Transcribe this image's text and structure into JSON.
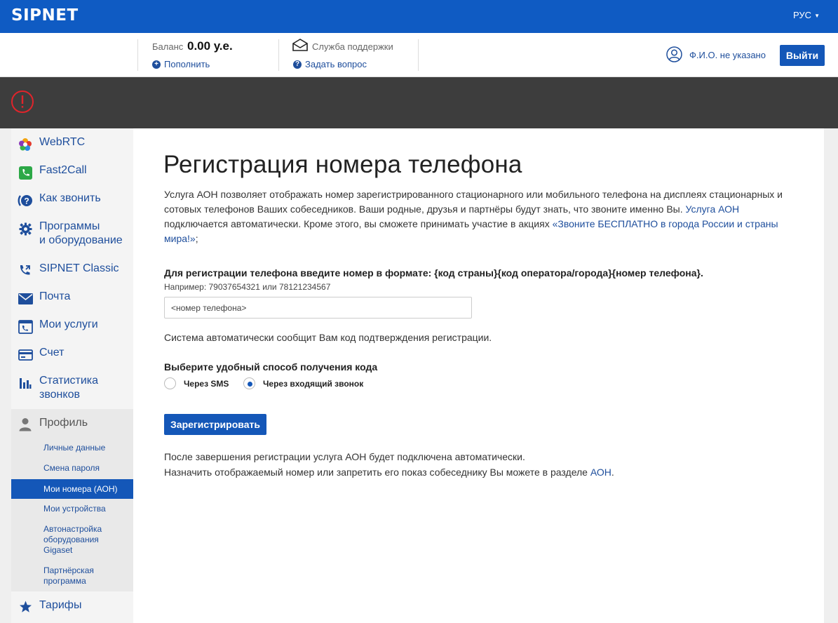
{
  "header": {
    "logo": "SIPNET",
    "language": "РУС"
  },
  "account": {
    "balance_label": "Баланс",
    "balance_value": "0.00 у.е.",
    "topup_label": "Пополнить",
    "support_label": "Служба поддержки",
    "ask_label": "Задать вопрос",
    "user_name": "Ф.И.О. не указано",
    "logout_label": "Выйти"
  },
  "sidebar": {
    "items": [
      {
        "label": "WebRTC",
        "icon": "webrtc-icon"
      },
      {
        "label": "Fast2Call",
        "icon": "phone-icon"
      },
      {
        "label": "Как звонить",
        "icon": "help-call-icon"
      },
      {
        "label": "Программы",
        "label2": "и оборудование",
        "icon": "gear-icon"
      },
      {
        "label": "SIPNET Classic",
        "icon": "phone-classic-icon"
      },
      {
        "label": "Почта",
        "icon": "envelope-icon"
      },
      {
        "label": "Мои услуги",
        "icon": "services-icon"
      },
      {
        "label": "Счет",
        "icon": "card-icon"
      },
      {
        "label": "Статистика",
        "label2": "звонков",
        "icon": "stats-icon"
      },
      {
        "label": "Профиль",
        "icon": "user-icon"
      }
    ],
    "sub_items": [
      {
        "label": "Личные данные"
      },
      {
        "label": "Смена пароля"
      },
      {
        "label": "Мои номера (АОН)",
        "active": true
      },
      {
        "label": "Мои устройства"
      },
      {
        "label": "Автонастройка",
        "label2": "оборудования",
        "label3": "Gigaset"
      },
      {
        "label": "Партнёрская",
        "label2": "программа"
      }
    ],
    "tariffs": {
      "label": "Тарифы",
      "icon": "star-icon"
    }
  },
  "main": {
    "title": "Регистрация номера телефона",
    "intro_text1": "Услуга АОН позволяет отображать номер зарегистрированного стационарного или мобильного телефона на дисплеях стационарных и сотовых телефонов Ваших собеседников. Ваши родные, друзья и партнёры будут знать, что звоните именно Вы. ",
    "intro_link1": "Услуга АОН",
    "intro_text2": " подключается автоматически. Кроме этого, вы сможете принимать участие в акциях ",
    "intro_link2": "«Звоните БЕСПЛАТНО в города России и страны мира!»",
    "intro_text3": ";",
    "instruction": "Для регистрации телефона введите номер в формате: {код страны}{код оператора/города}{номер телефона}.",
    "example": "Например: 79037654321 или 78121234567",
    "phone_placeholder": "<номер телефона>",
    "auto_message": "Система автоматически сообщит Вам код подтверждения регистрации.",
    "choose_label": "Выберите удобный способ получения кода",
    "radio_sms": "Через SMS",
    "radio_call": "Через входящий звонок",
    "selected_method": "Через входящий звонок",
    "register_button": "Зарегистрировать",
    "after_line1": "После завершения регистрации услуга АОН будет подключена автоматически.",
    "after_line2_text": "Назначить отображаемый номер или запретить его показ собеседнику Вы можете в разделе ",
    "after_line2_link": "АОН",
    "after_line2_end": "."
  },
  "colors": {
    "brand": "#0f5bc3",
    "button": "#1457b8",
    "link": "#1e4e9c",
    "alert_bar": "#3d3d3d",
    "alert_icon": "#e0242b"
  }
}
